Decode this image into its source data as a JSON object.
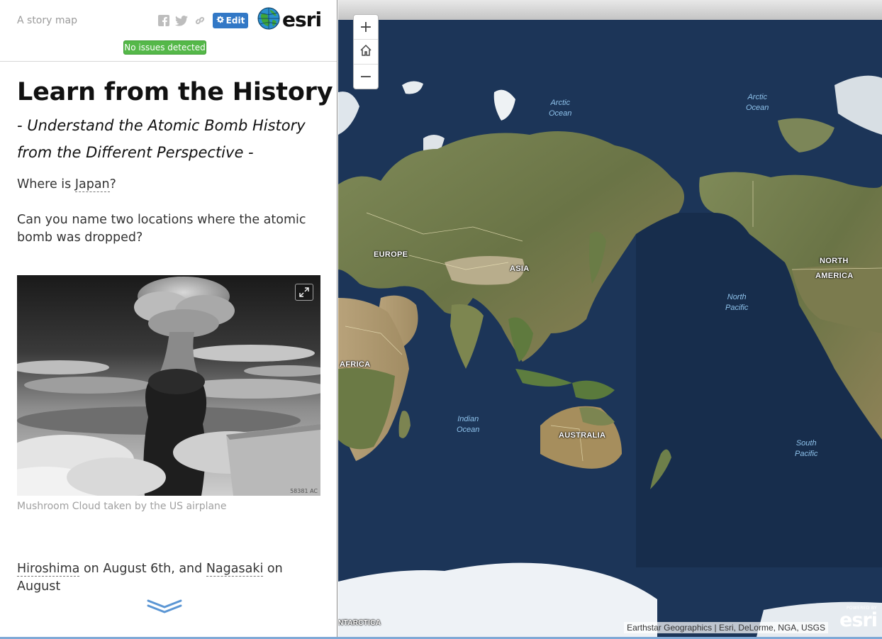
{
  "header": {
    "subtitle": "A story map",
    "edit_label": "Edit",
    "logo_text": "esri",
    "status": "No issues detected",
    "share_icons": [
      "facebook-icon",
      "twitter-icon",
      "link-icon"
    ]
  },
  "story": {
    "title": "Learn from the History",
    "subheading_line1": "- Understand the Atomic Bomb History",
    "subheading_line2": "from the Different Perspective -",
    "q1_prefix": "Where is ",
    "q1_link": "Japan",
    "q1_suffix": "?",
    "q2": "Can you name two locations where the atomic bomb was dropped?",
    "photo_code": "58381 AC",
    "caption": "Mushroom Cloud taken by the US airplane",
    "p3_link1": "Hiroshima",
    "p3_mid1": " on August 6th, and ",
    "p3_link2": "Nagasaki",
    "p3_mid2": " on August"
  },
  "map": {
    "zoom_in": "+",
    "zoom_out": "−",
    "labels": {
      "europe": "EUROPE",
      "asia": "ASIA",
      "africa": "AFRICA",
      "australia": "AUSTRALIA",
      "north_america_1": "NORTH",
      "north_america_2": "AMERICA",
      "antarctica": "NTARCTICA"
    },
    "oceans": {
      "arctic_1": "Arctic\nOcean",
      "arctic_2": "Arctic\nOcean",
      "north_pacific": "North\nPacific",
      "indian": "Indian\nOcean",
      "south_pacific": "South\nPacific"
    },
    "attribution": "Earthstar Geographics | Esri, DeLorme, NGA, USGS",
    "powered_small": "POWERED BY",
    "powered_big": "esri"
  },
  "colors": {
    "edit_button": "#3278c6",
    "status_badge": "#55b849",
    "ocean": "#1b3456",
    "land": "#6f7a4a"
  }
}
